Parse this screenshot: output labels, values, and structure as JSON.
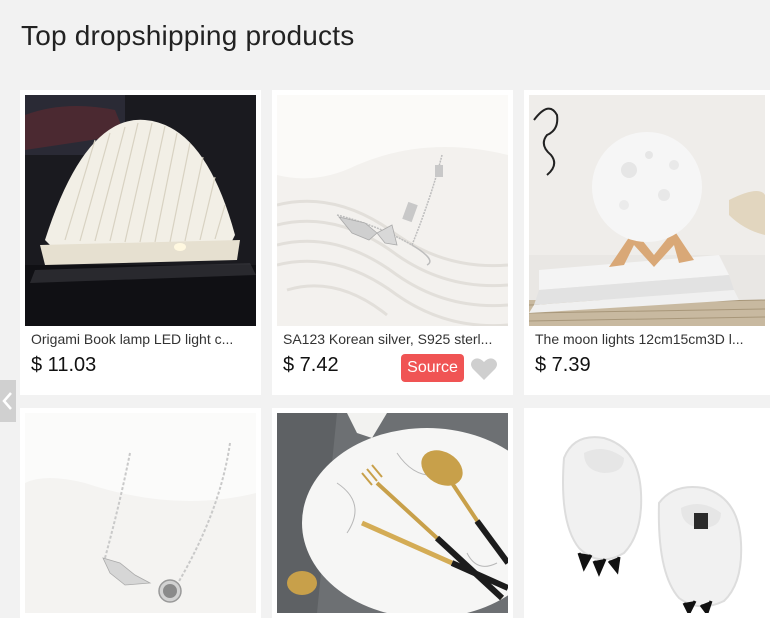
{
  "page": {
    "title": "Top dropshipping products"
  },
  "products": [
    {
      "name": "Origami Book lamp LED light c...",
      "price": "$ 11.03"
    },
    {
      "name": "SA123 Korean silver, S925 sterl...",
      "price": "$ 7.42"
    },
    {
      "name": "The moon lights 12cm15cm3D l...",
      "price": "$ 7.39"
    },
    {
      "name": "",
      "price": ""
    },
    {
      "name": "",
      "price": ""
    },
    {
      "name": "",
      "price": ""
    }
  ],
  "actions": {
    "source_label": "Source"
  },
  "icons": {
    "favorite": "heart-icon",
    "previous": "chevron-left-icon"
  },
  "colors": {
    "accent": "#f05454",
    "heart": "#cfcfcf",
    "background": "#f2f2f2"
  }
}
